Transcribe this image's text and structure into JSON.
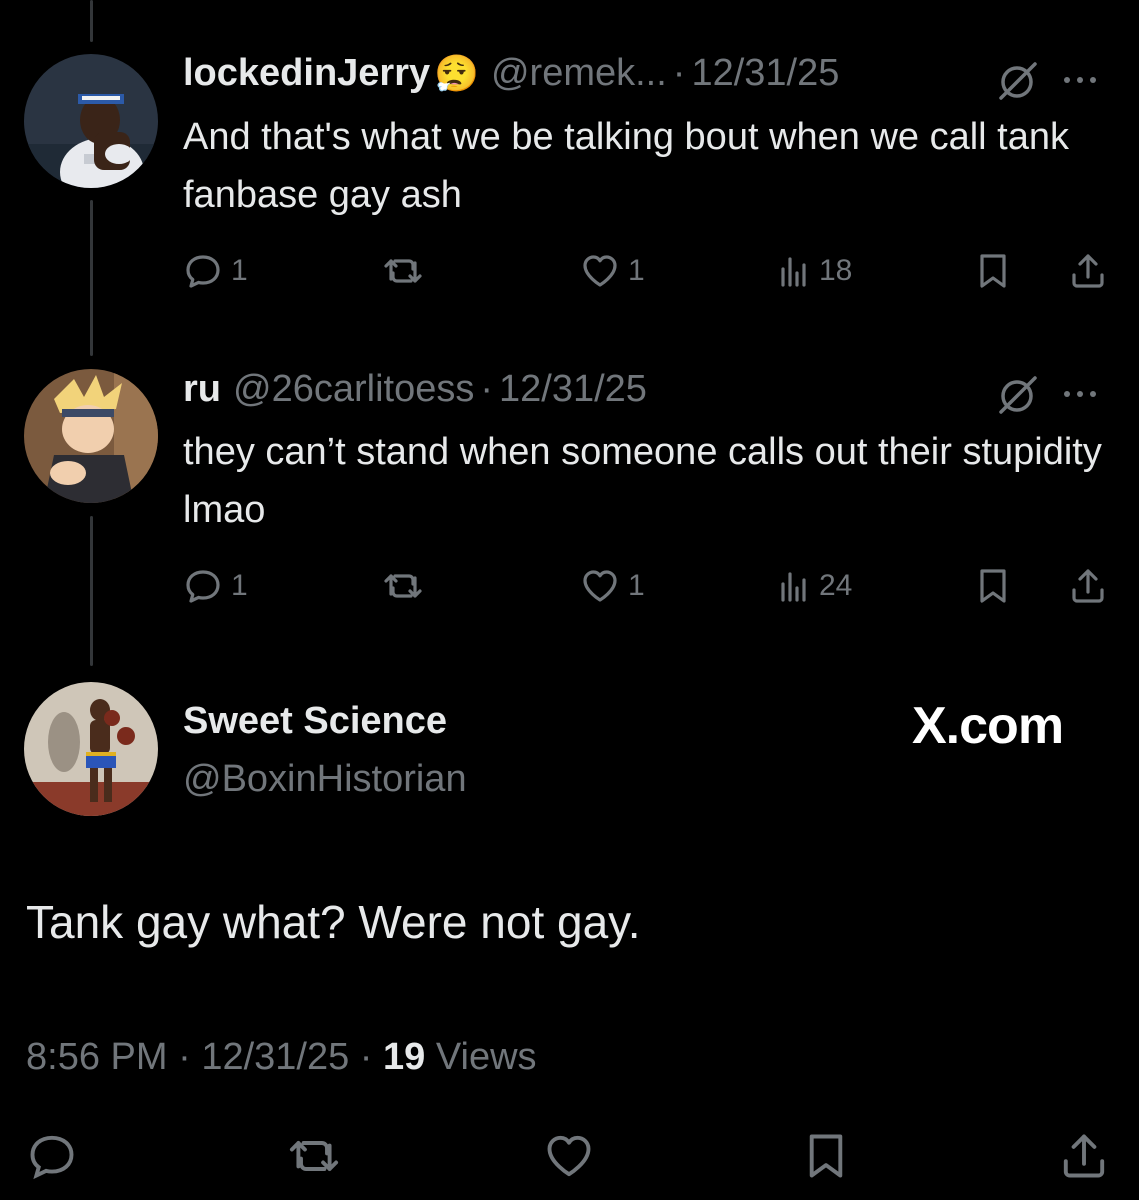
{
  "thread": [
    {
      "display_name": "lockedinJerry",
      "emoji": "😮‍💨",
      "handle": "@remek...",
      "date": "12/31/25",
      "text": "And that's what we be talking bout when we call tank fanbase gay ash",
      "replies": "1",
      "likes": "1",
      "views": "18"
    },
    {
      "display_name": "ru",
      "handle": "@26carlitoess",
      "date": "12/31/25",
      "text": "they can’t stand when someone calls out their stupidity lmao",
      "replies": "1",
      "likes": "1",
      "views": "24"
    }
  ],
  "main_post": {
    "display_name": "Sweet Science",
    "handle": "@BoxinHistorian",
    "watermark": "X.com",
    "text": "Tank gay what? Were not gay.",
    "time": "8:56 PM",
    "date": "12/31/25",
    "views_count": "19",
    "views_label": "Views"
  },
  "separator": "·",
  "icons": {
    "reply": "reply-icon",
    "repost": "repost-icon",
    "like": "heart-icon",
    "views": "views-icon",
    "bookmark": "bookmark-icon",
    "share": "share-icon",
    "grok": "grok-icon",
    "more": "more-icon"
  },
  "colors": {
    "background": "#000000",
    "text": "#e7e9ea",
    "muted": "#71767b",
    "thread_line": "#333639"
  }
}
